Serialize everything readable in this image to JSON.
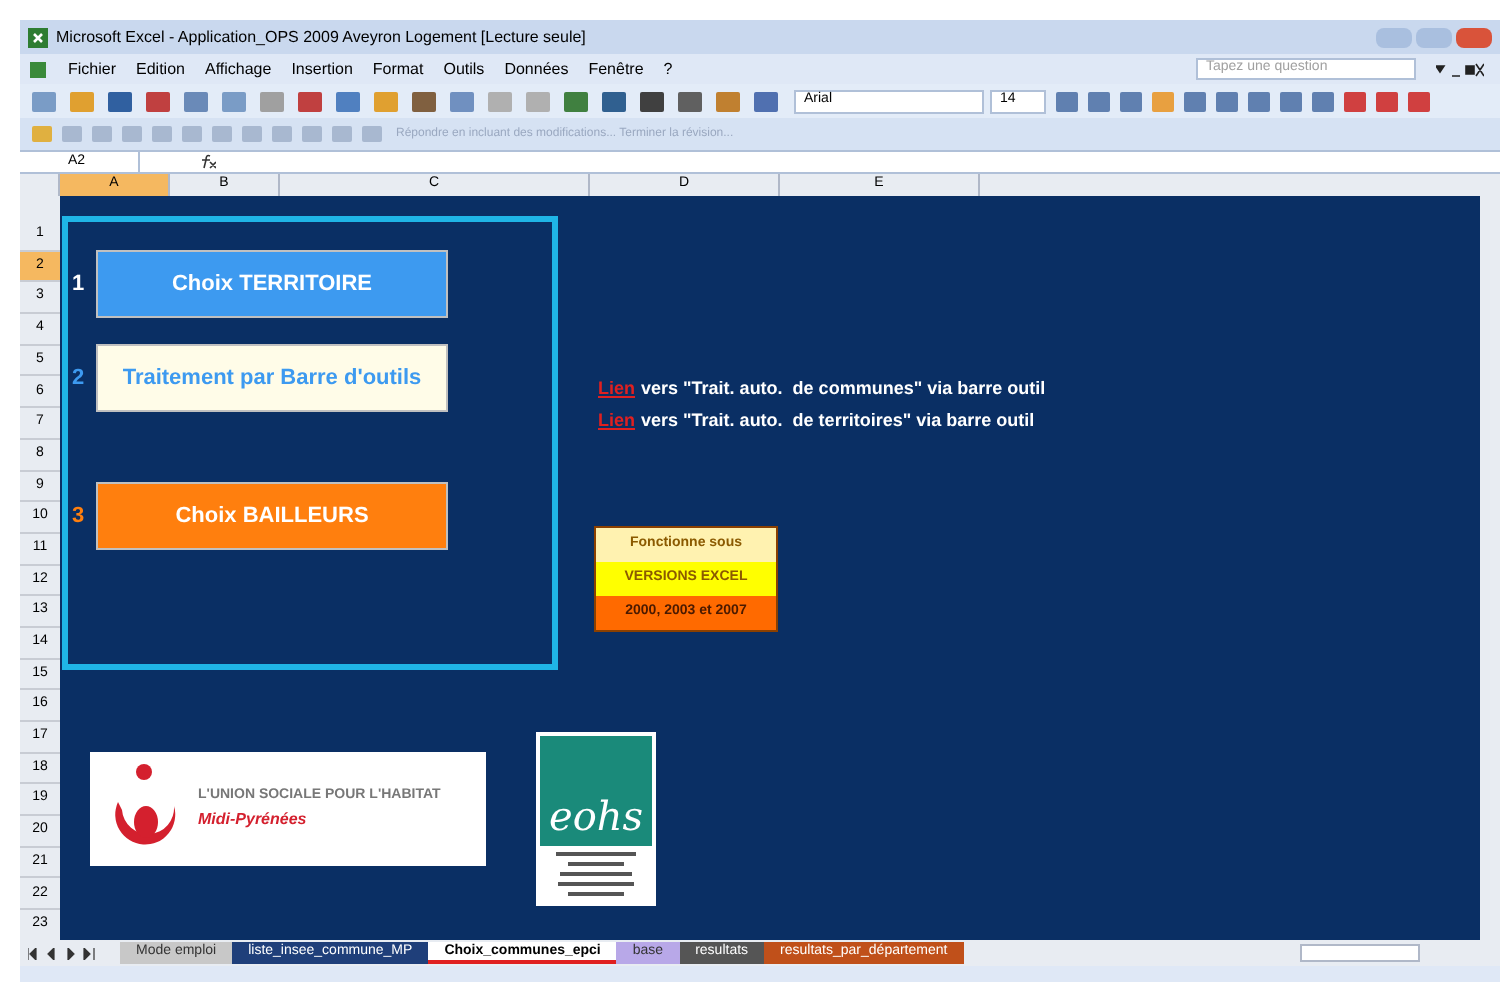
{
  "window": {
    "title": "Microsoft Excel - Application_OPS 2009 Aveyron Logement  [Lecture seule]"
  },
  "menu": [
    "Fichier",
    "Edition",
    "Affichage",
    "Insertion",
    "Format",
    "Outils",
    "Données",
    "Fenêtre",
    "?"
  ],
  "help_search": {
    "placeholder": "Tapez une question"
  },
  "format_toolbar": {
    "font": "Arial",
    "size": "14"
  },
  "review_toolbar": {
    "text": "Répondre en incluant des modifications...  Terminer la révision..."
  },
  "formula_bar": {
    "name_box": "A2"
  },
  "columns": [
    {
      "label": "A",
      "selected": true
    },
    {
      "label": "B",
      "selected": false
    },
    {
      "label": "C",
      "selected": false
    },
    {
      "label": "D",
      "selected": false
    },
    {
      "label": "E",
      "selected": false
    }
  ],
  "rows": [
    {
      "label": "1",
      "selected": false
    },
    {
      "label": "2",
      "selected": true
    },
    {
      "label": "3",
      "selected": false
    },
    {
      "label": "4",
      "selected": false
    },
    {
      "label": "5",
      "selected": false
    },
    {
      "label": "6",
      "selected": false
    },
    {
      "label": "7",
      "selected": false
    },
    {
      "label": "8",
      "selected": false
    },
    {
      "label": "9",
      "selected": false
    },
    {
      "label": "10",
      "selected": false
    },
    {
      "label": "11",
      "selected": false
    },
    {
      "label": "12",
      "selected": false
    },
    {
      "label": "13",
      "selected": false
    },
    {
      "label": "14",
      "selected": false
    },
    {
      "label": "15",
      "selected": false
    },
    {
      "label": "16",
      "selected": false
    },
    {
      "label": "17",
      "selected": false
    },
    {
      "label": "18",
      "selected": false
    },
    {
      "label": "19",
      "selected": false
    },
    {
      "label": "20",
      "selected": false
    },
    {
      "label": "21",
      "selected": false
    },
    {
      "label": "22",
      "selected": false
    },
    {
      "label": "23",
      "selected": false
    }
  ],
  "choices": [
    {
      "number": "1",
      "label": "Choix TERRITOIRE",
      "kind": "blue"
    },
    {
      "number": "2",
      "label": "Traitement par Barre d'outils",
      "kind": "cream"
    },
    {
      "number": "3",
      "label": "Choix BAILLEURS",
      "kind": "orange"
    }
  ],
  "links": [
    {
      "link": "Lien",
      "text": "vers \"Trait. auto.  de communes\" via barre outil"
    },
    {
      "link": "Lien",
      "text": "vers \"Trait. auto.  de territoires\" via barre outil"
    }
  ],
  "versions_note": [
    "Fonctionne sous",
    "VERSIONS EXCEL",
    "2000, 2003 et 2007"
  ],
  "logo_ush": {
    "name": "L'UNION SOCIALE POUR L'HABITAT",
    "region": "Midi-Pyrénées"
  },
  "logo_eohs": {
    "name": "eohs"
  },
  "sheet_tabs": [
    {
      "label": "Mode emploi",
      "color": "#c8c8c8",
      "selected": false
    },
    {
      "label": "liste_insee_commune_MP",
      "color": "#1f3f7a",
      "selected": false
    },
    {
      "label": "Choix_communes_epci",
      "color": "#ffffff",
      "selected": true
    },
    {
      "label": "base",
      "color": "#b8a8e8",
      "selected": false
    },
    {
      "label": "resultats",
      "color": "#555555",
      "selected": false
    },
    {
      "label": "resultats_par_département",
      "color": "#c0501a",
      "selected": false
    }
  ]
}
